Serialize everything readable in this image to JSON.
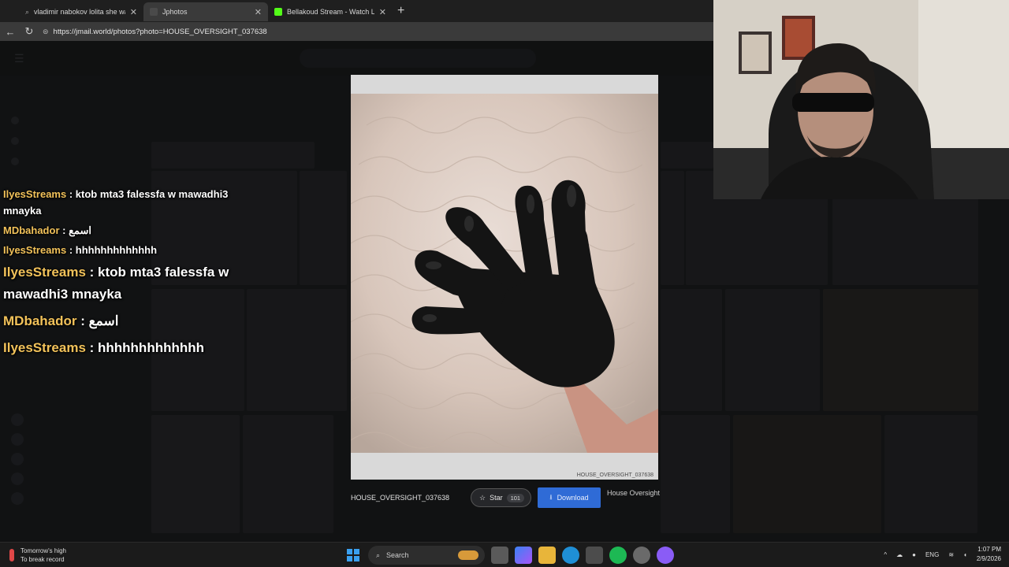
{
  "browser": {
    "tabs": [
      {
        "label": "vladimir nabokov lolita she was lo",
        "favicon": "search-icon",
        "active": false
      },
      {
        "label": "Jphotos",
        "favicon": "jphotos-icon",
        "active": true
      },
      {
        "label": "Bellakoud Stream - Watch Live on",
        "favicon": "kick-icon",
        "active": false
      }
    ],
    "close_glyph": "✕",
    "new_tab_glyph": "+",
    "url": "https://jmail.world/photos?photo=HOUSE_OVERSIGHT_037638"
  },
  "lightbox": {
    "photo_id_caption": "HOUSE_OVERSIGHT_037638",
    "filename": "HOUSE_OVERSIGHT_037638",
    "star_label": "Star",
    "star_count": "101",
    "download_label": "Download",
    "source_label": "House Oversight"
  },
  "chat": {
    "small": [
      {
        "user": "IlyesStreams",
        "text": " : ktob mta3 falessfa w mawadhi3 mnayka"
      },
      {
        "user": "MDbahador",
        "text": " : اسمع"
      },
      {
        "user": "IlyesStreams",
        "text": " : hhhhhhhhhhhhh"
      }
    ],
    "big": [
      {
        "user": "IlyesStreams",
        "text": " : ktob mta3 falessfa w mawadhi3 mnayka"
      },
      {
        "user": "MDbahador",
        "text": " : اسمع"
      },
      {
        "user": "IlyesStreams",
        "text": " : hhhhhhhhhhhhh"
      }
    ]
  },
  "taskbar": {
    "weather_line1": "Tomorrow's high",
    "weather_line2": "To break record",
    "search_label": "Search",
    "lang": "ENG",
    "time": "1:07 PM",
    "date": "2/9/2026"
  },
  "colors": {
    "chat_username": "#f2c25a",
    "download_button": "#2f6bd6",
    "tabbar_bg": "#1f1f1f"
  }
}
